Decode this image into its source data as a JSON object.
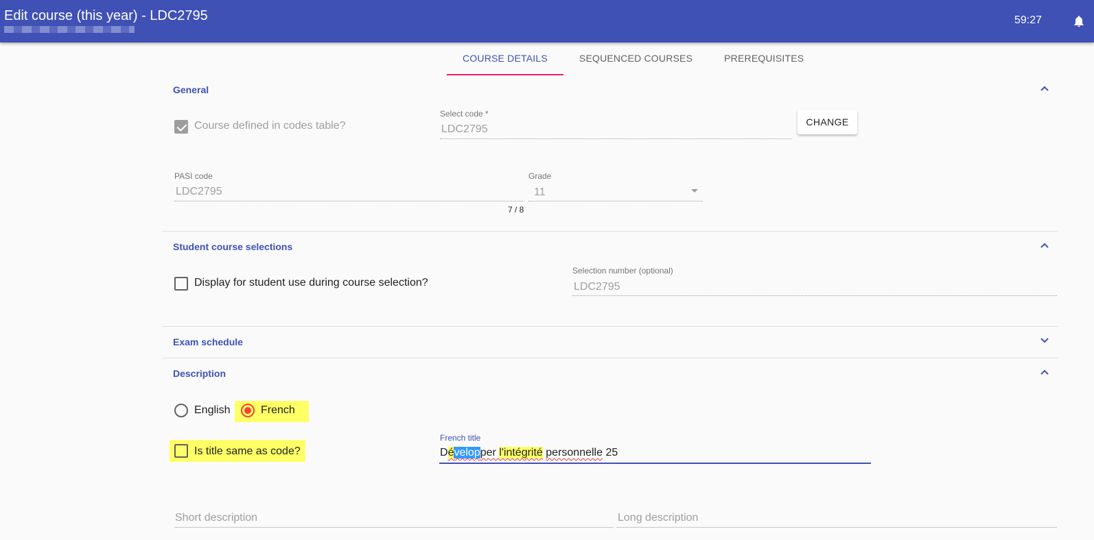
{
  "header": {
    "title": "Edit course (this year) - LDC2795",
    "timer": "59:27"
  },
  "tabs": [
    "COURSE DETAILS",
    "SEQUENCED COURSES",
    "PREREQUISITES"
  ],
  "general": {
    "title": "General",
    "course_defined_label": "Course defined in codes table?",
    "select_code_label": "Select code *",
    "select_code_value": "LDC2795",
    "change_button": "CHANGE",
    "pasi_code_label": "PASI code",
    "pasi_code_value": "LDC2795",
    "pasi_counter": "7 / 8",
    "grade_label": "Grade",
    "grade_value": "11"
  },
  "student_selections": {
    "title": "Student course selections",
    "display_label": "Display for student use during course selection?",
    "selection_number_label": "Selection number (optional)",
    "selection_number_value": "LDC2795"
  },
  "exam_schedule": {
    "title": "Exam schedule"
  },
  "description": {
    "title": "Description",
    "english_label": "English",
    "french_label": "French",
    "title_same_label": "Is title same as code?",
    "french_title_label": "French title",
    "french_title_parts": {
      "p1": "D",
      "p2": "é",
      "p3": "velop",
      "p4": "per ",
      "p5": "l'intégrité",
      "p6": " ",
      "p7": "personnelle",
      "p8": " 25"
    },
    "short_description_placeholder": "Short description",
    "long_description_placeholder": "Long description"
  },
  "colors": {
    "primary": "#3f51b5",
    "tab_indicator": "#e91e63",
    "radio_selected": "#f44336",
    "highlight": "#ffff66"
  }
}
